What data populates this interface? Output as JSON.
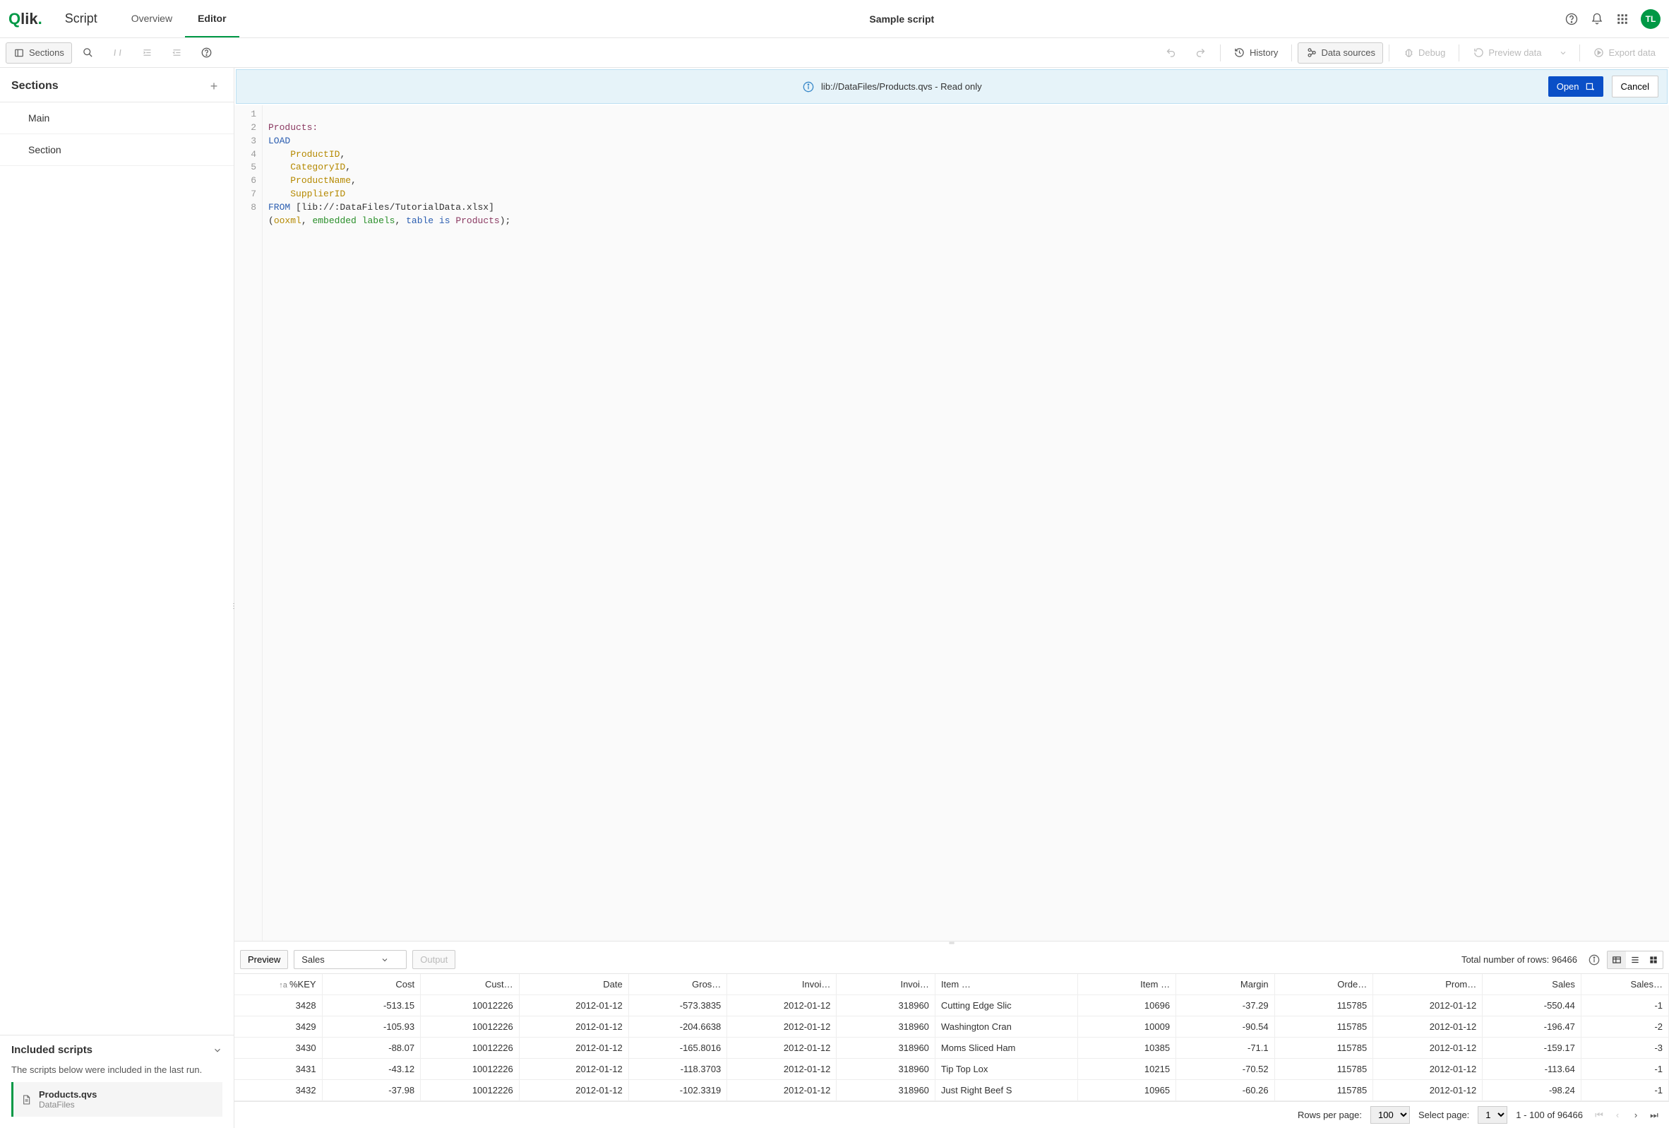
{
  "header": {
    "logo": "Qlik",
    "script_label": "Script",
    "tabs": {
      "overview": "Overview",
      "editor": "Editor"
    },
    "title": "Sample script",
    "avatar": "TL"
  },
  "toolbar": {
    "sections": "Sections",
    "history": "History",
    "data_sources": "Data sources",
    "debug": "Debug",
    "preview_data": "Preview data",
    "export_data": "Export data"
  },
  "sidebar": {
    "title": "Sections",
    "items": [
      "Main",
      "Section"
    ],
    "included": {
      "title": "Included scripts",
      "note": "The scripts below were included in the last run.",
      "file": {
        "name": "Products.qvs",
        "location": "DataFiles"
      }
    }
  },
  "banner": {
    "path": "lib://DataFiles/Products.qvs - Read only",
    "open": "Open",
    "cancel": "Cancel"
  },
  "code": {
    "lines": [
      "1",
      "2",
      "3",
      "4",
      "5",
      "6",
      "7",
      "8"
    ],
    "l1_section": "Products:",
    "l2_kw": "LOAD",
    "l3_field": "ProductID",
    "l3_tail": ",",
    "l4_field": "CategoryID",
    "l4_tail": ",",
    "l5_field": "ProductName",
    "l5_tail": ",",
    "l6_field": "SupplierID",
    "l7_kw": "FROM",
    "l7_path": " [lib://:DataFiles/TutorialData.xlsx]",
    "l8_open": "(",
    "l8_ooxml": "ooxml",
    "l8_c1": ", ",
    "l8_embedded": "embedded",
    "l8_sp": " ",
    "l8_labels": "labels",
    "l8_c2": ", ",
    "l8_table": "table",
    "l8_is": " is ",
    "l8_products": "Products",
    "l8_close": ");"
  },
  "preview": {
    "btn": "Preview",
    "table_select": "Sales",
    "output": "Output",
    "total_label": "Total number of rows: ",
    "total_value": "96466",
    "columns": [
      "%KEY",
      "Cost",
      "Cust…",
      "Date",
      "Gros…",
      "Invoi…",
      "Invoi…",
      "Item …",
      "Item …",
      "Margin",
      "Orde…",
      "Prom…",
      "Sales",
      "Sales…"
    ],
    "col_sort_icon": "↑a",
    "rows": [
      [
        "3428",
        "-513.15",
        "10012226",
        "2012-01-12",
        "-573.3835",
        "2012-01-12",
        "318960",
        "Cutting Edge Slic",
        "10696",
        "-37.29",
        "115785",
        "2012-01-12",
        "-550.44",
        "-1"
      ],
      [
        "3429",
        "-105.93",
        "10012226",
        "2012-01-12",
        "-204.6638",
        "2012-01-12",
        "318960",
        "Washington Cran",
        "10009",
        "-90.54",
        "115785",
        "2012-01-12",
        "-196.47",
        "-2"
      ],
      [
        "3430",
        "-88.07",
        "10012226",
        "2012-01-12",
        "-165.8016",
        "2012-01-12",
        "318960",
        "Moms Sliced Ham",
        "10385",
        "-71.1",
        "115785",
        "2012-01-12",
        "-159.17",
        "-3"
      ],
      [
        "3431",
        "-43.12",
        "10012226",
        "2012-01-12",
        "-118.3703",
        "2012-01-12",
        "318960",
        "Tip Top Lox",
        "10215",
        "-70.52",
        "115785",
        "2012-01-12",
        "-113.64",
        "-1"
      ],
      [
        "3432",
        "-37.98",
        "10012226",
        "2012-01-12",
        "-102.3319",
        "2012-01-12",
        "318960",
        "Just Right Beef S",
        "10965",
        "-60.26",
        "115785",
        "2012-01-12",
        "-98.24",
        "-1"
      ]
    ]
  },
  "pager": {
    "rows_label": "Rows per page:",
    "rows_value": "100",
    "page_label": "Select page:",
    "page_value": "1",
    "range": "1 - 100 of 96466"
  }
}
